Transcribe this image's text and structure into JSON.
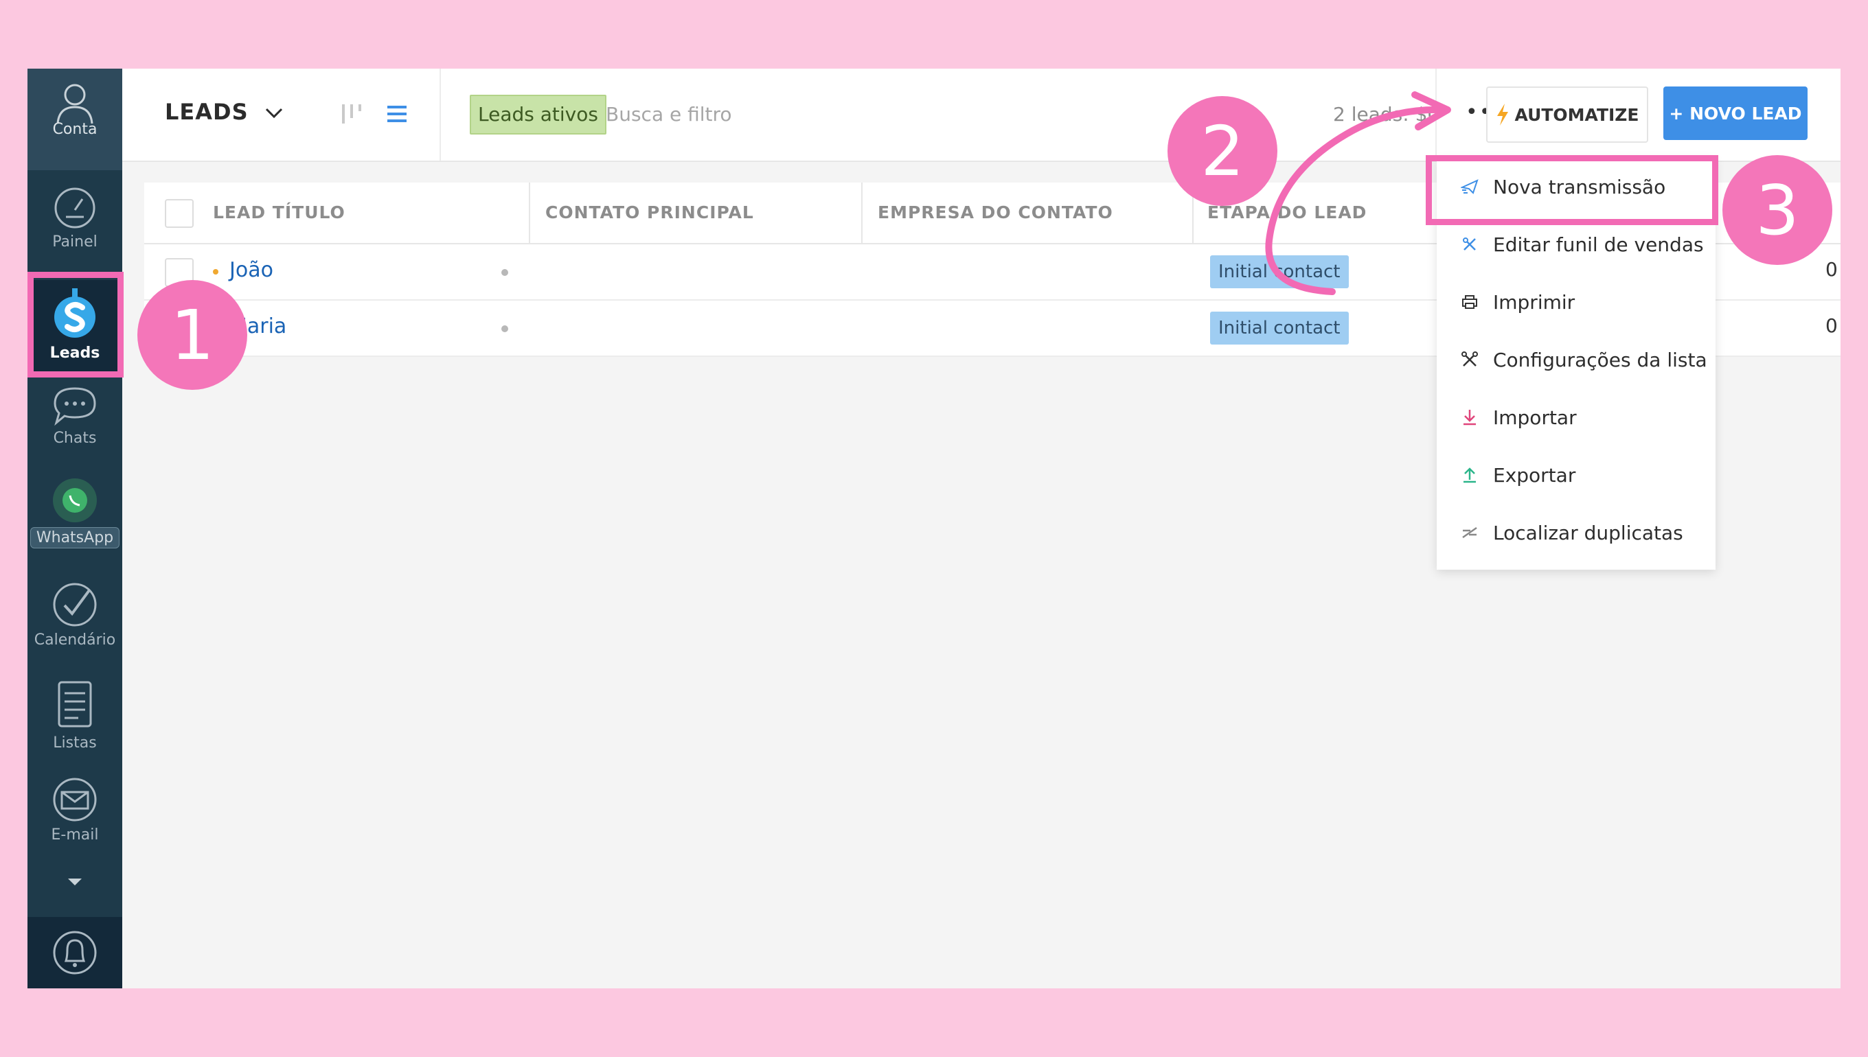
{
  "sidebar": {
    "items": [
      {
        "label": "Conta",
        "icon": "user-icon"
      },
      {
        "label": "Painel",
        "icon": "speedometer-icon"
      },
      {
        "label": "Leads",
        "icon": "dollar-icon"
      },
      {
        "label": "Chats",
        "icon": "chat-icon"
      },
      {
        "label": "WhatsApp",
        "icon": "whatsapp-icon"
      },
      {
        "label": "Calendário",
        "icon": "check-circle-icon"
      },
      {
        "label": "Listas",
        "icon": "list-icon"
      },
      {
        "label": "E-mail",
        "icon": "mail-icon"
      }
    ],
    "notifications_icon": "bell-icon"
  },
  "header": {
    "title": "LEADS",
    "filter_tag": "Leads ativos",
    "search_placeholder": "Busca e filtro",
    "summary": "2 leads: $0",
    "more_icon": "•••",
    "automate_label": "AUTOMATIZE",
    "new_lead_label": "+ NOVO LEAD"
  },
  "table": {
    "columns": [
      "LEAD TÍTULO",
      "CONTATO PRINCIPAL",
      "EMPRESA DO CONTATO",
      "ETAPA DO LEAD"
    ],
    "rows": [
      {
        "title": "João",
        "stage": "Initial contact",
        "value": "0"
      },
      {
        "title": "Maria",
        "stage": "Initial contact",
        "value": "0"
      }
    ]
  },
  "menu": {
    "items": [
      {
        "label": "Nova transmissão",
        "icon": "paper-plane-icon",
        "color": "#3e8fe6"
      },
      {
        "label": "Editar funil de vendas",
        "icon": "tools-icon",
        "color": "#3e8fe6"
      },
      {
        "label": "Imprimir",
        "icon": "printer-icon",
        "color": "#333333"
      },
      {
        "label": "Configurações da lista",
        "icon": "wrench-icon",
        "color": "#333333"
      },
      {
        "label": "Importar",
        "icon": "download-icon",
        "color": "#e0457b"
      },
      {
        "label": "Exportar",
        "icon": "upload-icon",
        "color": "#2bb58a"
      },
      {
        "label": "Localizar duplicatas",
        "icon": "merge-icon",
        "color": "#888888"
      }
    ]
  },
  "annotations": {
    "step1": "1",
    "step2": "2",
    "step3": "3",
    "accent_color": "#f26ab4"
  },
  "colors": {
    "background": "#fcc8e0",
    "sidebar": "#1e3a4a",
    "primary_button": "#3e8fe6",
    "stage_badge": "#9fcdf2",
    "filter_tag": "#c8e3a8"
  }
}
